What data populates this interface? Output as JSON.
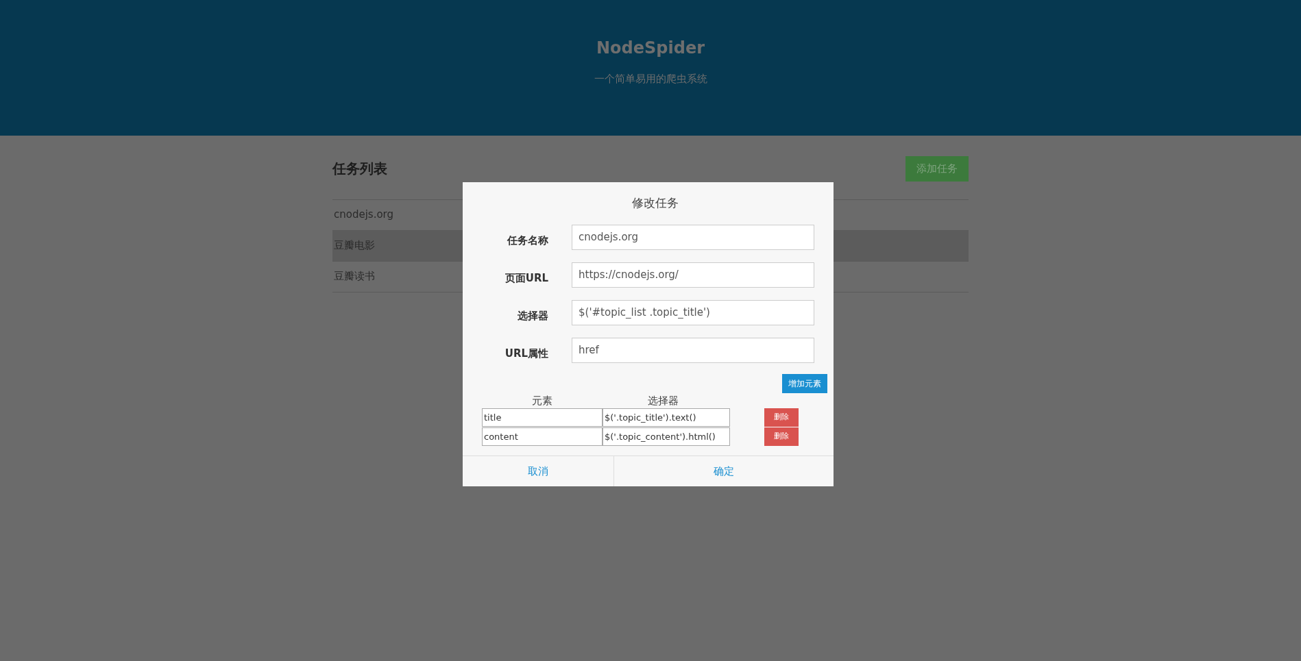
{
  "header": {
    "title": "NodeSpider",
    "subtitle": "一个简单易用的爬虫系统"
  },
  "task_list": {
    "title": "任务列表",
    "add_button": "添加任务",
    "items": [
      {
        "label": "cnodejs.org",
        "selected": false
      },
      {
        "label": "豆瓣电影",
        "selected": true
      },
      {
        "label": "豆瓣读书",
        "selected": false
      }
    ]
  },
  "dialog": {
    "title": "修改任务",
    "fields": [
      {
        "label": "任务名称",
        "value": "cnodejs.org"
      },
      {
        "label": "页面URL",
        "value": "https://cnodejs.org/"
      },
      {
        "label": "选择器",
        "value": "$('#topic_list .topic_title')"
      },
      {
        "label": "URL属性",
        "value": "href"
      }
    ],
    "add_element_button": "增加元素",
    "element_columns": [
      "元素",
      "选择器"
    ],
    "elements": [
      {
        "name": "title",
        "selector": "$('.topic_title').text()",
        "delete_button": "删除"
      },
      {
        "name": "content",
        "selector": "$('.topic_content').html()",
        "delete_button": "删除"
      }
    ],
    "buttons": [
      {
        "label": "取消"
      },
      {
        "label": "确定"
      }
    ]
  }
}
